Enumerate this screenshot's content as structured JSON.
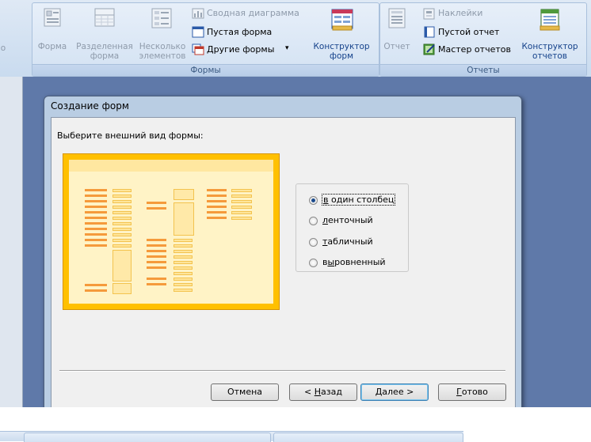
{
  "ribbon": {
    "groups": {
      "forms": {
        "title": "Формы",
        "form": "Форма",
        "split_form": [
          "Разделенная",
          "форма"
        ],
        "multiple_items": [
          "Несколько",
          "элементов"
        ],
        "pivot_chart": "Сводная диаграмма",
        "blank_form": "Пустая форма",
        "more_forms": "Другие формы",
        "form_designer": [
          "Конструктор",
          "форм"
        ]
      },
      "reports": {
        "title": "Отчеты",
        "report": "Отчет",
        "labels": "Наклейки",
        "blank_report": "Пустой отчет",
        "report_wizard": "Мастер отчетов",
        "report_designer": [
          "Конструктор",
          "отчетов"
        ]
      }
    },
    "left_cut_label": "о"
  },
  "dialog": {
    "title": "Создание форм",
    "prompt": "Выберите внешний вид формы:",
    "options": [
      {
        "label": "в один столбец",
        "selected": true
      },
      {
        "label": "ленточный",
        "selected": false
      },
      {
        "label": "табличный",
        "selected": false
      },
      {
        "label": "выровненный",
        "selected": false
      }
    ],
    "buttons": {
      "cancel": "Отмена",
      "back": "< Назад",
      "next": "Далее >",
      "finish": "Готово"
    }
  },
  "colors": {
    "workspace": "#5f79a9",
    "preview_frame": "#ffc000",
    "preview_bar": "#f59a3b",
    "ribbon_text": "#15428b"
  }
}
